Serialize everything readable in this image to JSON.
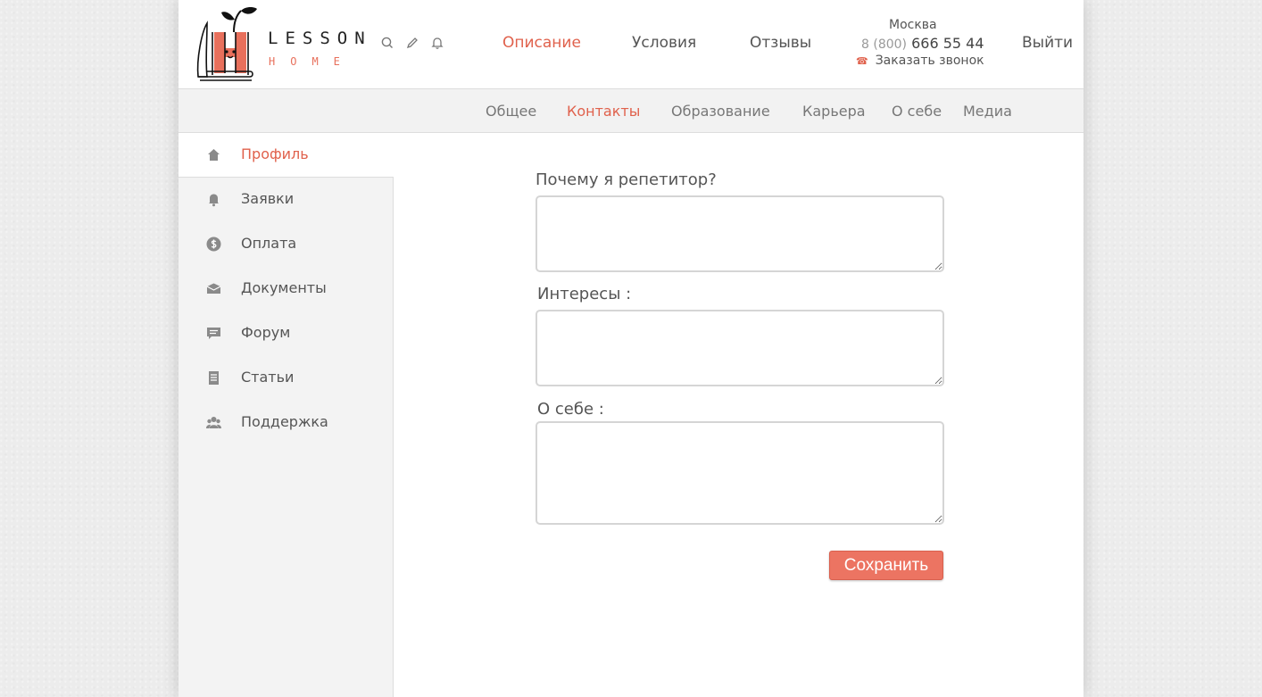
{
  "brand": {
    "word": "LESSON",
    "sub": "HOME"
  },
  "header": {
    "icons": [
      "search-icon",
      "pencil-icon",
      "bell-icon"
    ],
    "nav": [
      {
        "label": "Описание",
        "active": true
      },
      {
        "label": "Условия",
        "active": false
      },
      {
        "label": "Отзывы",
        "active": false
      }
    ],
    "contact": {
      "city": "Москва",
      "phone_prefix": "8 (800)",
      "phone_number": "666 55 44",
      "callback_icon": "phone-icon",
      "callback_label": "Заказать звонок"
    },
    "logout_label": "Выйти"
  },
  "subnav": [
    {
      "label": "Общее",
      "active": false
    },
    {
      "label": "Контакты",
      "active": true
    },
    {
      "label": "Образование",
      "active": false
    },
    {
      "label": "Карьера",
      "active": false
    },
    {
      "label": "О себе",
      "active": false
    },
    {
      "label": "Медиа",
      "active": false
    }
  ],
  "sidebar": [
    {
      "label": "Профиль",
      "icon": "home-icon",
      "active": true
    },
    {
      "label": "Заявки",
      "icon": "bell-icon",
      "active": false
    },
    {
      "label": "Оплата",
      "icon": "dollar-icon",
      "active": false
    },
    {
      "label": "Документы",
      "icon": "briefcase-icon",
      "active": false
    },
    {
      "label": "Форум",
      "icon": "chat-icon",
      "active": false
    },
    {
      "label": "Статьи",
      "icon": "document-icon",
      "active": false
    },
    {
      "label": "Поддержка",
      "icon": "users-icon",
      "active": false
    }
  ],
  "form": {
    "fields": [
      {
        "label": "Почему я репетитор?",
        "value": ""
      },
      {
        "label": "Интересы :",
        "value": ""
      },
      {
        "label": "О себе :",
        "value": ""
      }
    ],
    "save_label": "Сохранить"
  },
  "colors": {
    "accent": "#e0614c",
    "button": "#ec7462",
    "sidebar_bg": "#f3f3f3"
  }
}
